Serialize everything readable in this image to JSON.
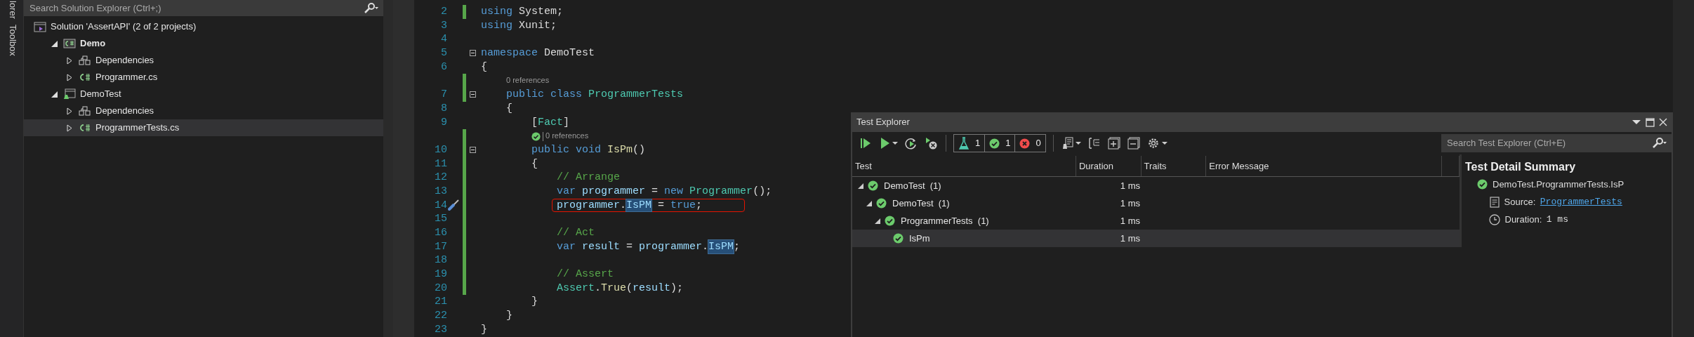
{
  "side_tabs": [
    {
      "label": "lorer"
    },
    {
      "label": "Toolbox"
    }
  ],
  "solution_explorer": {
    "search": {
      "placeholder": "Search Solution Explorer (Ctrl+;)"
    },
    "tree": [
      {
        "label": "Solution 'AssertAPI' (2 of 2 projects)",
        "kind": "solution",
        "selected": false,
        "startup": false,
        "children": [
          {
            "label": "Demo",
            "kind": "project",
            "expanded": true,
            "selected": false,
            "startup": true,
            "children": [
              {
                "label": "Dependencies",
                "kind": "dependencies",
                "expanded": false,
                "selected": false,
                "startup": false
              },
              {
                "label": "Programmer.cs",
                "kind": "csfile",
                "expanded": false,
                "selected": false,
                "startup": false
              }
            ]
          },
          {
            "label": "DemoTest",
            "kind": "testproject",
            "expanded": true,
            "selected": false,
            "startup": false,
            "children": [
              {
                "label": "Dependencies",
                "kind": "dependencies",
                "expanded": false,
                "selected": false,
                "startup": false
              },
              {
                "label": "ProgrammerTests.cs",
                "kind": "csfile",
                "expanded": false,
                "selected": true,
                "startup": false
              }
            ]
          }
        ]
      }
    ]
  },
  "editor": {
    "lines": [
      {
        "number": "2",
        "changed": true,
        "foldable": false,
        "tokens": [
          {
            "text": "using",
            "kind": "keyword"
          },
          {
            "text": " System;",
            "kind": "plain"
          }
        ]
      },
      {
        "number": "3",
        "changed": false,
        "foldable": false,
        "tokens": [
          {
            "text": "using",
            "kind": "keyword"
          },
          {
            "text": " Xunit;",
            "kind": "plain"
          }
        ]
      },
      {
        "number": "4",
        "changed": false,
        "foldable": false
      },
      {
        "number": "5",
        "changed": false,
        "foldable": true,
        "tokens": [
          {
            "text": "namespace",
            "kind": "keyword"
          },
          {
            "text": " DemoTest",
            "kind": "plain"
          }
        ]
      },
      {
        "number": "6",
        "changed": false,
        "foldable": false,
        "tokens": [
          {
            "text": "{",
            "kind": "plain"
          }
        ]
      },
      {
        "number": "7",
        "changed": true,
        "foldable": true,
        "codelens": {
          "text": "0 references",
          "test_passed": false
        },
        "tokens": [
          {
            "text": "    public class",
            "kind": "keyword"
          },
          {
            "text": " ProgrammerTests",
            "kind": "type"
          }
        ]
      },
      {
        "number": "8",
        "changed": false,
        "foldable": false,
        "tokens": [
          {
            "text": "    {",
            "kind": "plain"
          }
        ]
      },
      {
        "number": "9",
        "changed": false,
        "foldable": false,
        "tokens": [
          {
            "text": "        [",
            "kind": "plain"
          },
          {
            "text": "Fact",
            "kind": "type"
          },
          {
            "text": "]",
            "kind": "plain"
          }
        ]
      },
      {
        "number": "10",
        "changed": true,
        "foldable": true,
        "codelens": {
          "text": "0 references",
          "test_passed": true
        },
        "tokens": [
          {
            "text": "        public void",
            "kind": "keyword"
          },
          {
            "text": " IsPm",
            "kind": "method"
          },
          {
            "text": "()",
            "kind": "plain"
          }
        ]
      },
      {
        "number": "11",
        "changed": true,
        "foldable": false,
        "tokens": [
          {
            "text": "        {",
            "kind": "plain"
          }
        ]
      },
      {
        "number": "12",
        "changed": true,
        "foldable": false,
        "tokens": [
          {
            "text": "            // Arrange",
            "kind": "comment"
          }
        ]
      },
      {
        "number": "13",
        "changed": true,
        "foldable": false,
        "tokens": [
          {
            "text": "            var",
            "kind": "keyword"
          },
          {
            "text": " programmer",
            "kind": "variable"
          },
          {
            "text": " = ",
            "kind": "plain"
          },
          {
            "text": "new",
            "kind": "keyword"
          },
          {
            "text": " Programmer",
            "kind": "type"
          },
          {
            "text": "();",
            "kind": "plain"
          }
        ]
      },
      {
        "number": "14",
        "changed": true,
        "foldable": false,
        "quick_action": true,
        "boxed": true,
        "tokens": [
          {
            "text": "            programmer",
            "kind": "variable"
          },
          {
            "text": ".",
            "kind": "plain"
          },
          {
            "text": "IsPM",
            "kind": "variable",
            "highlighted": true
          },
          {
            "text": " = ",
            "kind": "plain"
          },
          {
            "text": "true",
            "kind": "keyword"
          },
          {
            "text": ";",
            "kind": "plain"
          }
        ]
      },
      {
        "number": "15",
        "changed": true,
        "foldable": false
      },
      {
        "number": "16",
        "changed": true,
        "foldable": false,
        "tokens": [
          {
            "text": "            // Act",
            "kind": "comment"
          }
        ]
      },
      {
        "number": "17",
        "changed": true,
        "foldable": false,
        "tokens": [
          {
            "text": "            var",
            "kind": "keyword"
          },
          {
            "text": " result",
            "kind": "variable"
          },
          {
            "text": " = ",
            "kind": "plain"
          },
          {
            "text": "programmer",
            "kind": "variable"
          },
          {
            "text": ".",
            "kind": "plain"
          },
          {
            "text": "IsPM",
            "kind": "variable",
            "highlighted": true
          },
          {
            "text": ";",
            "kind": "plain"
          }
        ]
      },
      {
        "number": "18",
        "changed": true,
        "foldable": false
      },
      {
        "number": "19",
        "changed": true,
        "foldable": false,
        "tokens": [
          {
            "text": "            // Assert",
            "kind": "comment"
          }
        ]
      },
      {
        "number": "20",
        "changed": true,
        "foldable": false,
        "tokens": [
          {
            "text": "            Assert",
            "kind": "type"
          },
          {
            "text": ".",
            "kind": "plain"
          },
          {
            "text": "True",
            "kind": "method"
          },
          {
            "text": "(",
            "kind": "plain"
          },
          {
            "text": "result",
            "kind": "variable"
          },
          {
            "text": ");",
            "kind": "plain"
          }
        ]
      },
      {
        "number": "21",
        "changed": false,
        "foldable": false,
        "tokens": [
          {
            "text": "        }",
            "kind": "plain"
          }
        ]
      },
      {
        "number": "22",
        "changed": false,
        "foldable": false,
        "tokens": [
          {
            "text": "    }",
            "kind": "plain"
          }
        ]
      },
      {
        "number": "23",
        "changed": false,
        "foldable": false,
        "tokens": [
          {
            "text": "}",
            "kind": "plain"
          }
        ]
      }
    ]
  },
  "test_explorer": {
    "title": "Test Explorer",
    "counters": [
      {
        "kind": "total",
        "value": "1"
      },
      {
        "kind": "passed",
        "value": "1"
      },
      {
        "kind": "failed",
        "value": "0"
      }
    ],
    "search": {
      "placeholder": "Search Test Explorer (Ctrl+E)"
    },
    "columns": [
      "Test",
      "Duration",
      "Traits",
      "Error Message"
    ],
    "rows": [
      {
        "name": "DemoTest",
        "count": "(1)",
        "duration": "1 ms",
        "passed": true,
        "expanded": true,
        "selected": false,
        "children": [
          {
            "name": "DemoTest",
            "count": "(1)",
            "duration": "1 ms",
            "passed": true,
            "expanded": true,
            "selected": false,
            "children": [
              {
                "name": "ProgrammerTests",
                "count": "(1)",
                "duration": "1 ms",
                "passed": true,
                "expanded": true,
                "selected": false,
                "children": [
                  {
                    "name": "IsPm",
                    "duration": "1 ms",
                    "passed": true,
                    "selected": true
                  }
                ]
              }
            ]
          }
        ]
      }
    ],
    "detail": {
      "title": "Test Detail Summary",
      "test_name": "DemoTest.ProgrammerTests.IsP",
      "passed": true,
      "source_label": "Source:",
      "source_link": "ProgrammerTests",
      "duration_label": "Duration:",
      "duration_value": "1 ms"
    }
  }
}
